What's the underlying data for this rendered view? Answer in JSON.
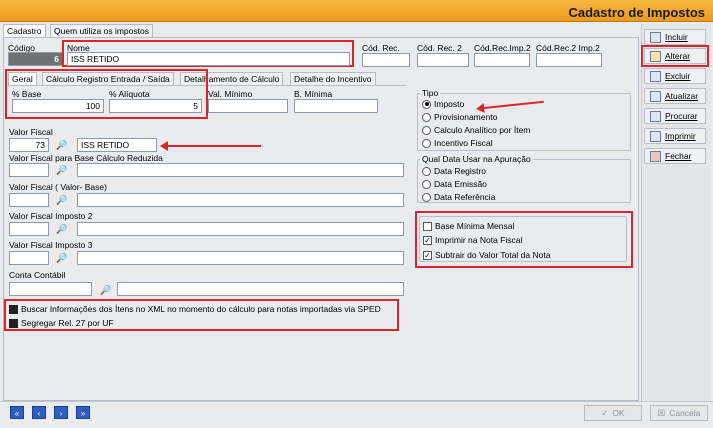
{
  "window": {
    "title": "Cadastro de Impostos"
  },
  "top_tabs": [
    "Cadastro",
    "Quem utiliza os impostos"
  ],
  "header": {
    "codigo_label": "Código",
    "codigo_value": "6",
    "nome_label": "Nome",
    "nome_value": "ISS RETIDO",
    "cod_rec_label": "Cód. Rec.",
    "cod_rec2_label": "Cód. Rec. 2",
    "cod_rec_imp2_label": "Cód.Rec.Imp.2",
    "cod_rec2_imp2_label": "Cód.Rec.2 Imp.2"
  },
  "inner_tabs": [
    "Geral",
    "Cálculo Registro Entrada / Saída",
    "Detalhamento de Cálculo",
    "Detalhe do Incentivo"
  ],
  "geral": {
    "base_label": "% Base",
    "base_value": "100",
    "aliquota_label": "% Alíquota",
    "aliquota_value": "5",
    "val_minimo_label": "Val. Mínimo",
    "b_minima_label": "B. Mínima"
  },
  "fields": {
    "valor_fiscal_label": "Valor Fiscal",
    "valor_fiscal_code": "73",
    "valor_fiscal_desc": "ISS RETIDO",
    "vf_base_reduzida_label": "Valor Fiscal para Base Cálculo Reduzida",
    "vf_valor_base_label": "Valor Fiscal ( Valor- Base)",
    "vf_imposto2_label": "Valor Fiscal Imposto 2",
    "vf_imposto3_label": "Valor Fiscal Imposto 3",
    "conta_contabil_label": "Conta Contábil"
  },
  "options": {
    "buscar_xml": "Buscar Informações dos Ítens no XML no momento do cálculo para notas importadas via SPED",
    "segregar": "Segregar Rel. 27 por UF"
  },
  "tipo": {
    "title": "Tipo",
    "items": [
      "Imposto",
      "Provisionamento",
      "Calculo Analítico por Ítem",
      "Incentivo Fiscal"
    ],
    "selected": "Imposto"
  },
  "apuracao": {
    "title": "Qual Data Usar na Apuração",
    "items": [
      "Data Registro",
      "Data Emissão",
      "Data Referência"
    ]
  },
  "checks": {
    "base_minima": "Base Mínima Mensal",
    "imprimir_nota": "Imprimir na Nota Fiscal",
    "subtrair_total": "Subtrair do Valor Total da Nota"
  },
  "side_buttons": [
    "Incluir",
    "Alterar",
    "Excluir",
    "Atualizar",
    "Procurar",
    "Imprimir",
    "Fechar"
  ],
  "bottom": {
    "ok_label": "OK",
    "cancel_label": "Cancela"
  },
  "colors": {
    "title_bar": "#f2a52d",
    "highlight": "#d9262b",
    "nav": "#2c5fc0"
  }
}
